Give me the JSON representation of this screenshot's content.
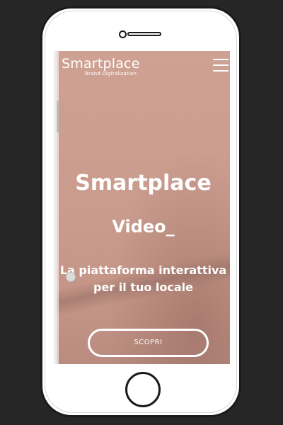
{
  "header": {
    "logo_title": "Smartplace",
    "logo_tagline": "Brand Digitalization",
    "menu_icon": "hamburger-menu-icon"
  },
  "hero": {
    "title": "Smartplace",
    "subtitle": "Video_",
    "description_line1": "La piattaforma interattiva",
    "description_line2": "per il tuo locale",
    "cta_label": "SCOPRI"
  },
  "colors": {
    "background": "#262626",
    "phone_body": "#ffffff",
    "phone_outline": "#1a1a1a",
    "screen_tint": "#c99b8d",
    "text": "#ffffff"
  }
}
